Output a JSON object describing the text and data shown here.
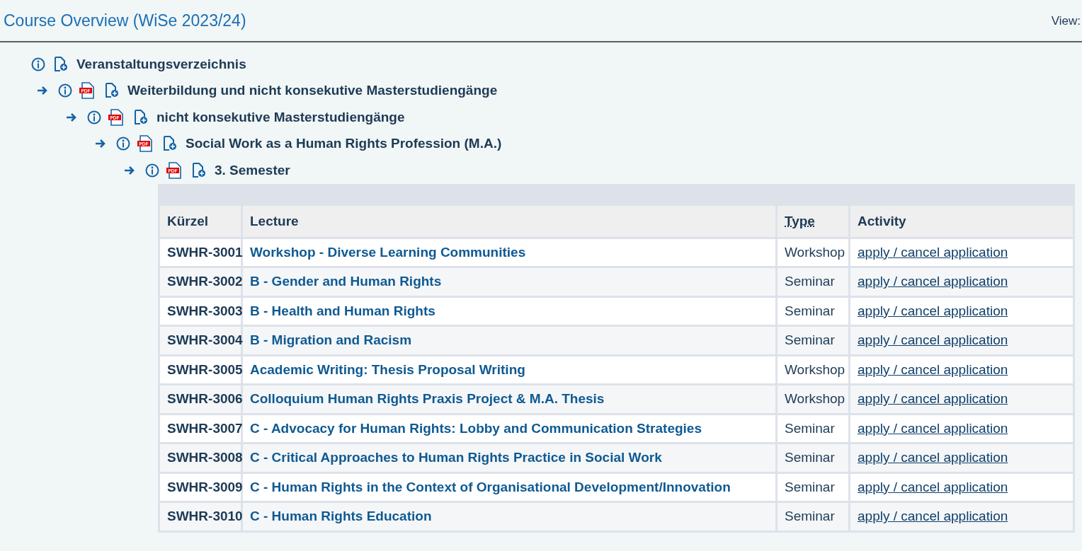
{
  "header": {
    "title": "Course Overview (WiSe 2023/24)",
    "view_label": "View:"
  },
  "tree": [
    {
      "kind": "root",
      "label": "Veranstaltungsverzeichnis",
      "children": [
        {
          "kind": "branch",
          "pdf_label": "PDF",
          "label": "Weiterbildung und nicht konsekutive Masterstudiengänge",
          "children": [
            {
              "kind": "branch",
              "pdf_label": "PDF",
              "label": "nicht konsekutive Masterstudiengänge",
              "children": [
                {
                  "kind": "branch",
                  "pdf_label": "PDF",
                  "label": "Social Work as a Human Rights Profession (M.A.)",
                  "children": [
                    {
                      "kind": "branch",
                      "pdf_label": "PDF",
                      "label": "3. Semester"
                    }
                  ]
                }
              ]
            }
          ]
        }
      ]
    }
  ],
  "table": {
    "columns": [
      {
        "label": "Kürzel",
        "kind": "plain"
      },
      {
        "label": "Lecture",
        "kind": "plain"
      },
      {
        "label": "Type",
        "kind": "abbr"
      },
      {
        "label": "Activity",
        "kind": "plain"
      }
    ],
    "rows": [
      {
        "code": "SWHR-3001",
        "lecture": "Workshop - Diverse Learning Communities",
        "type": "Workshop",
        "activity": "apply / cancel application"
      },
      {
        "code": "SWHR-3002",
        "lecture": "B - Gender and Human Rights",
        "type": "Seminar",
        "activity": "apply / cancel application"
      },
      {
        "code": "SWHR-3003",
        "lecture": "B - Health and Human Rights",
        "type": "Seminar",
        "activity": "apply / cancel application"
      },
      {
        "code": "SWHR-3004",
        "lecture": "B - Migration and Racism",
        "type": "Seminar",
        "activity": "apply / cancel application"
      },
      {
        "code": "SWHR-3005",
        "lecture": "Academic Writing: Thesis Proposal Writing",
        "type": "Workshop",
        "activity": "apply / cancel application"
      },
      {
        "code": "SWHR-3006",
        "lecture": "Colloquium Human Rights Praxis Project & M.A. Thesis",
        "type": "Workshop",
        "activity": "apply / cancel application"
      },
      {
        "code": "SWHR-3007",
        "lecture": "C - Advocacy for Human Rights: Lobby and Communication Strategies",
        "type": "Seminar",
        "activity": "apply / cancel application"
      },
      {
        "code": "SWHR-3008",
        "lecture": "C - Critical Approaches to Human Rights Practice in Social Work",
        "type": "Seminar",
        "activity": "apply / cancel application"
      },
      {
        "code": "SWHR-3009",
        "lecture": "C - Human Rights in the Context of Organisational Development/Innovation",
        "type": "Seminar",
        "activity": "apply / cancel application"
      },
      {
        "code": "SWHR-3010",
        "lecture": "C - Human Rights Education",
        "type": "Seminar",
        "activity": "apply / cancel application"
      }
    ]
  }
}
